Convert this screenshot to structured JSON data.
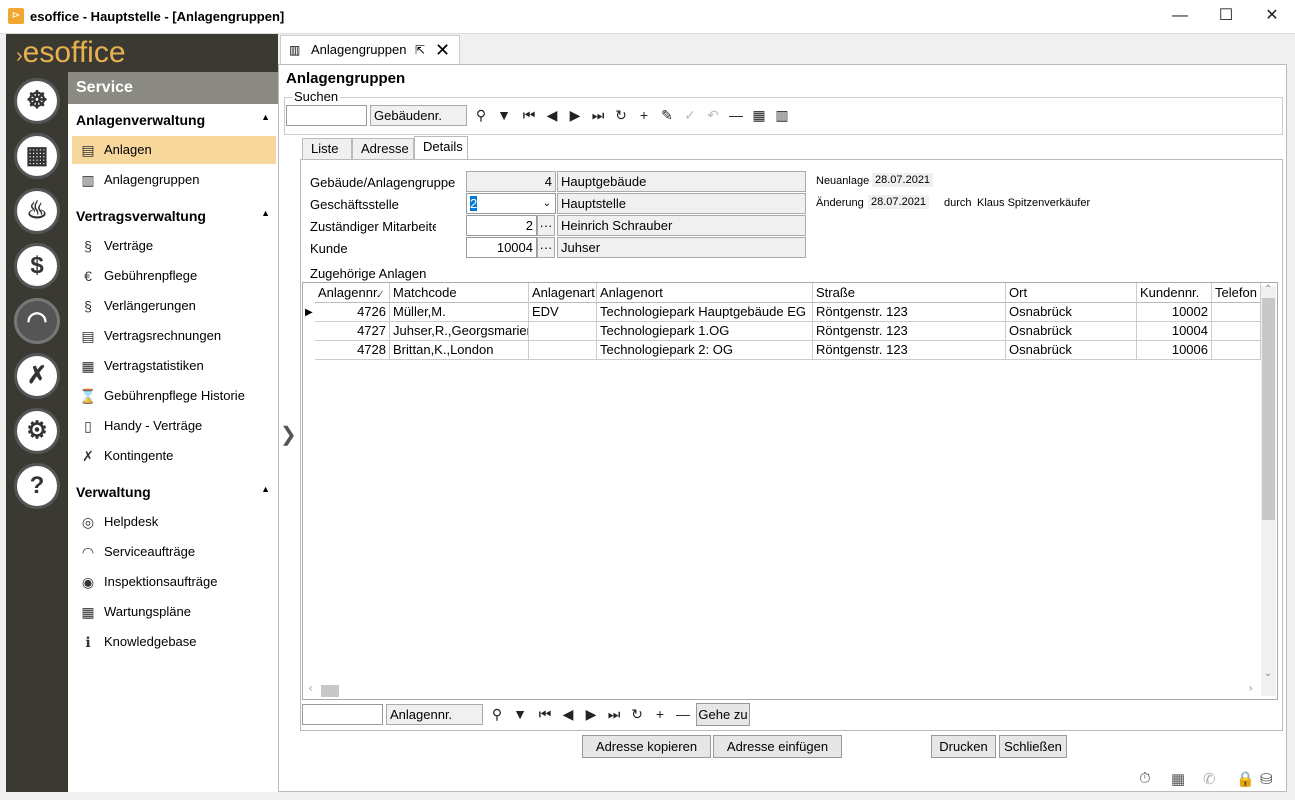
{
  "window": {
    "title": "esoffice - Hauptstelle - [Anlagengruppen]",
    "minimize": "—",
    "maximize": "☐",
    "close": "✕"
  },
  "app": {
    "logo": "esoffice"
  },
  "sidebar": {
    "header": "Service",
    "sections": [
      {
        "title": "Anlagenverwaltung",
        "items": [
          "Anlagen",
          "Anlagengruppen"
        ]
      },
      {
        "title": "Vertragsverwaltung",
        "items": [
          "Verträge",
          "Gebührenpflege",
          "Verlängerungen",
          "Vertragsrechnungen",
          "Vertragstatistiken",
          "Gebührenpflege Historie",
          "Handy - Verträge",
          "Kontingente"
        ]
      },
      {
        "title": "Verwaltung",
        "items": [
          "Helpdesk",
          "Serviceaufträge",
          "Inspektionsaufträge",
          "Wartungspläne",
          "Knowledgebase"
        ]
      }
    ]
  },
  "tab": {
    "label": "Anlagengruppen"
  },
  "page": {
    "title": "Anlagengruppen"
  },
  "search": {
    "legend": "Suchen",
    "value": "",
    "field": "Gebäudenr."
  },
  "detail_tabs": [
    "Liste",
    "Adresse",
    "Details"
  ],
  "form": {
    "gebaeude_label": "Gebäude/Anlagengruppe",
    "gebaeude_nr": "4",
    "gebaeude_name": "Hauptgebäude",
    "gs_label": "Geschäftsstelle",
    "gs_nr": "2",
    "gs_name": "Hauptstelle",
    "ma_label": "Zuständiger Mitarbeiter",
    "ma_nr": "2",
    "ma_name": "Heinrich Schrauber",
    "kunde_label": "Kunde",
    "kunde_nr": "10004",
    "kunde_name": "Juhser",
    "neuanlage_label": "Neuanlage",
    "neuanlage_date": "28.07.2021",
    "aenderung_label": "Änderung",
    "aenderung_date": "28.07.2021",
    "durch_label": "durch",
    "durch_name": "Klaus Spitzenverkäufer"
  },
  "grid": {
    "title": "Zugehörige Anlagen",
    "columns": [
      "Anlagennr.",
      "Matchcode",
      "Anlagenart",
      "Anlagenort",
      "Straße",
      "Ort",
      "Kundennr.",
      "Telefon"
    ],
    "rows": [
      [
        "4726",
        "Müller,M.",
        "EDV",
        "Technologiepark Hauptgebäude EG",
        "Röntgenstr. 123",
        "Osnabrück",
        "10002",
        ""
      ],
      [
        "4727",
        "Juhser,R.,Georgsmarienhütte",
        "",
        "Technologiepark 1.OG",
        "Röntgenstr. 123",
        "Osnabrück",
        "10004",
        ""
      ],
      [
        "4728",
        "Brittan,K.,London",
        "",
        "Technologiepark 2: OG",
        "Röntgenstr. 123",
        "Osnabrück",
        "10006",
        ""
      ]
    ]
  },
  "grid_search": {
    "value": "",
    "field": "Anlagennr.",
    "goto": "Gehe zu"
  },
  "buttons": {
    "copy": "Adresse kopieren",
    "paste": "Adresse einfügen",
    "print": "Drucken",
    "close": "Schließen"
  }
}
